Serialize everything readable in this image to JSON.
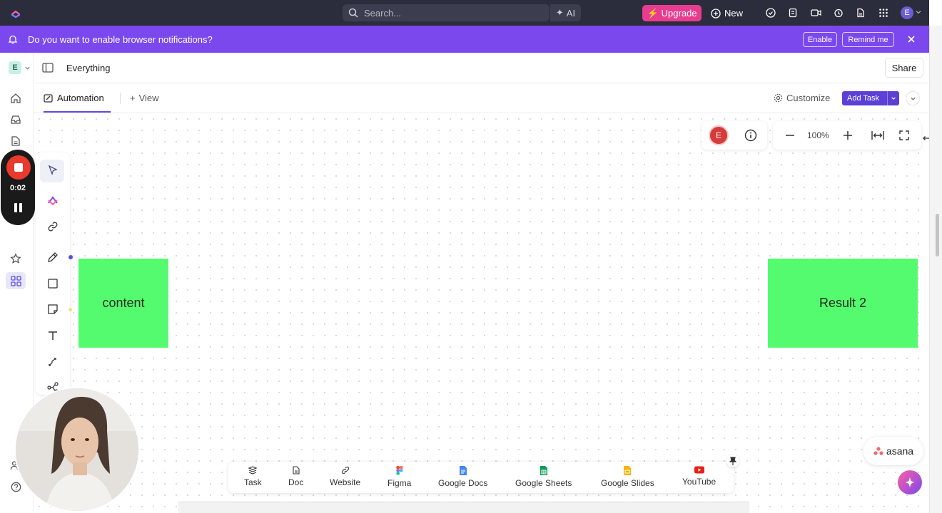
{
  "topbar": {
    "search_placeholder": "Search...",
    "ai_label": "AI",
    "upgrade_label": "Upgrade",
    "new_label": "New",
    "avatar_initial": "E"
  },
  "notification": {
    "message": "Do you want to enable browser notifications?",
    "enable_label": "Enable",
    "remind_label": "Remind me"
  },
  "workspace": {
    "initial": "E"
  },
  "header": {
    "title": "Everything",
    "share_label": "Share"
  },
  "tabs": {
    "active_label": "Automation",
    "view_label": "View",
    "customize_label": "Customize",
    "add_task_label": "Add Task"
  },
  "recorder": {
    "time": "0:02"
  },
  "canvas": {
    "stickies": [
      {
        "text": "content",
        "color": "#55fb6e"
      },
      {
        "text": "Result 2",
        "color": "#55fb6e"
      }
    ],
    "zoom": "100%",
    "viewer_initial": "E"
  },
  "embeds": [
    {
      "label": "Task",
      "icon": "task-icon"
    },
    {
      "label": "Doc",
      "icon": "doc-icon"
    },
    {
      "label": "Website",
      "icon": "link-icon"
    },
    {
      "label": "Figma",
      "icon": "figma-icon"
    },
    {
      "label": "Google Docs",
      "icon": "google-docs-icon"
    },
    {
      "label": "Google Sheets",
      "icon": "google-sheets-icon"
    },
    {
      "label": "Google Slides",
      "icon": "google-slides-icon"
    },
    {
      "label": "YouTube",
      "icon": "youtube-icon"
    }
  ],
  "asana_label": "asana",
  "colors": {
    "accent": "#7b48ee",
    "upgrade": "#e73c8f",
    "sticky": "#55fb6e",
    "topbar": "#2b2c3c"
  }
}
